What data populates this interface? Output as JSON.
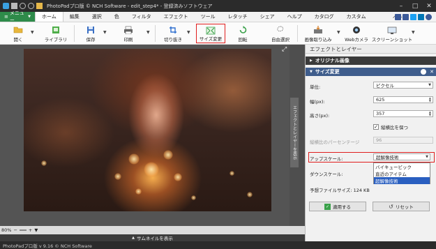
{
  "title_bar": {
    "title": "PhotoPadプロ版 © NCH Software - edit_step4* - 登録済みソフトウェア"
  },
  "menu": {
    "menu_button": "メニュー",
    "items": [
      "ホーム",
      "編集",
      "選択",
      "色",
      "フィルタ",
      "エフェクト",
      "ツール",
      "レタッチ",
      "シェア",
      "ヘルプ",
      "カタログ",
      "カスタム"
    ],
    "active_item": "ホーム",
    "beta": "ベータ"
  },
  "ribbon": {
    "buttons": [
      "開く",
      "ライブラリ",
      "保存",
      "印刷",
      "切り抜き",
      "サイズ変更",
      "回転",
      "自由選択",
      "画像取り込み",
      "Webカメラ",
      "スクリーンショット"
    ],
    "highlighted": "サイズ変更"
  },
  "canvas": {
    "zoom": "80%",
    "thumbnail_toggle": "サムネイルを表示",
    "side_tab": "エフェクトとレイヤーを表示"
  },
  "status": "PhotoPadプロ版 v 9.16 © NCH Software",
  "panel": {
    "title": "エフェクトとレイヤー",
    "section_original": "オリジナル画像",
    "section_resize": "サイズ変更",
    "unit_label": "単位:",
    "unit_value": "ピクセル",
    "width_label": "幅(px):",
    "width_value": "625",
    "height_label": "高さ(px):",
    "height_value": "357",
    "keep_ratio_label": "縦横比を保つ",
    "keep_ratio_checked": true,
    "ratio_label": "縦横比のパーセンテージ",
    "ratio_value": "96",
    "upscale_label": "アップスケール:",
    "upscale_value": "超解像技術",
    "upscale_options": [
      "バイキュービック",
      "直近のアイテム",
      "超解像技術"
    ],
    "downscale_label": "ダウンスケール:",
    "filesize_label": "予想ファイルサイズ:",
    "filesize_value": "124 KB",
    "apply_button": "適用する",
    "reset_button": "リセット"
  },
  "colors": {
    "accent_green": "#2e8b4a",
    "highlight_red": "#e01d1d",
    "section_blue": "#3f5d8c"
  }
}
